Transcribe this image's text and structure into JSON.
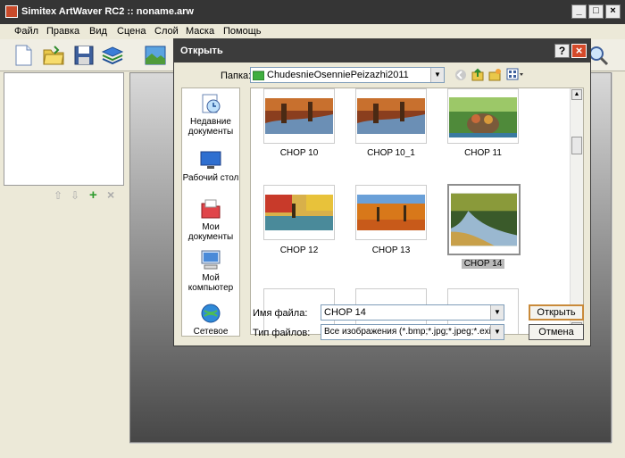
{
  "window": {
    "title": "Simitex ArtWaver RC2 :: noname.arw"
  },
  "menu": [
    "Файл",
    "Правка",
    "Вид",
    "Сцена",
    "Слой",
    "Маска",
    "Помощь"
  ],
  "dialog": {
    "title": "Открыть",
    "folder_label": "Папка:",
    "folder_value": "ChudesnieOsenniePeizazhi2011",
    "places": [
      "Недавние документы",
      "Рабочий стол",
      "Мои документы",
      "Мой компьютер",
      "Сетевое"
    ],
    "files": [
      {
        "name": "CHOP 10"
      },
      {
        "name": "CHOP 10_1"
      },
      {
        "name": "CHOP 11"
      },
      {
        "name": "CHOP 12"
      },
      {
        "name": "CHOP 13"
      },
      {
        "name": "CHOP 14"
      }
    ],
    "selected_file": "CHOP 14",
    "filename_label": "Имя файла:",
    "filename_value": "CHOP 14",
    "filetype_label": "Тип файлов:",
    "filetype_value": "Все изображения (*.bmp;*.jpg;*.jpeg;*.exif;*.gif",
    "open_button": "Открыть",
    "cancel_button": "Отмена"
  },
  "colors": {
    "titlebar": "#353535",
    "dialog_title": "#3c3c3c",
    "close_button": "#d54a2a",
    "selection": "#b9b9b9"
  }
}
